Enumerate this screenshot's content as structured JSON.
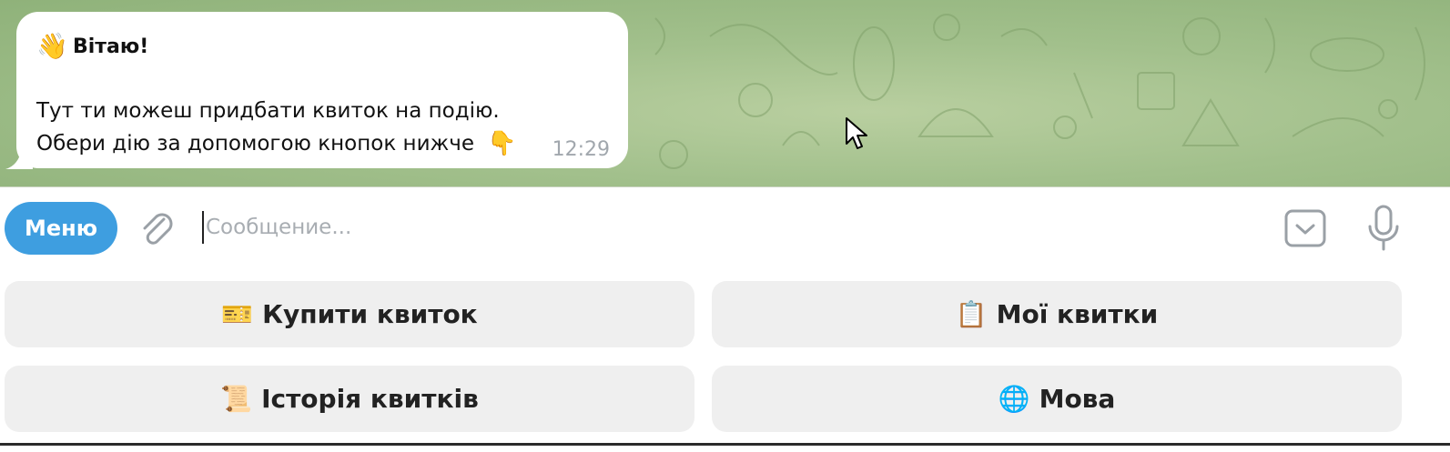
{
  "chat": {
    "message": {
      "greeting_emoji": "👋",
      "greeting": "Вітаю!",
      "line1": "Тут ти можеш придбати квиток на подію.",
      "line2": "Обери дію за допомогою кнопок нижче",
      "line2_emoji": "👇",
      "time": "12:29"
    }
  },
  "input_bar": {
    "menu_label": "Меню",
    "placeholder": "Сообщение...",
    "value": ""
  },
  "keyboard": {
    "buttons": [
      {
        "emoji": "🎫",
        "label": "Купити квиток"
      },
      {
        "emoji": "📋",
        "label": "Мої квитки"
      },
      {
        "emoji": "📜",
        "label": "Історія квитків"
      },
      {
        "emoji": "🌐",
        "label": "Мова"
      }
    ]
  },
  "colors": {
    "accent": "#3e9ee0",
    "wallpaper": "#a2c08c",
    "button_bg": "#efefef"
  },
  "icons": {
    "attach": "paperclip-icon",
    "keyboard": "keyboard-toggle-icon",
    "mic": "microphone-icon"
  }
}
